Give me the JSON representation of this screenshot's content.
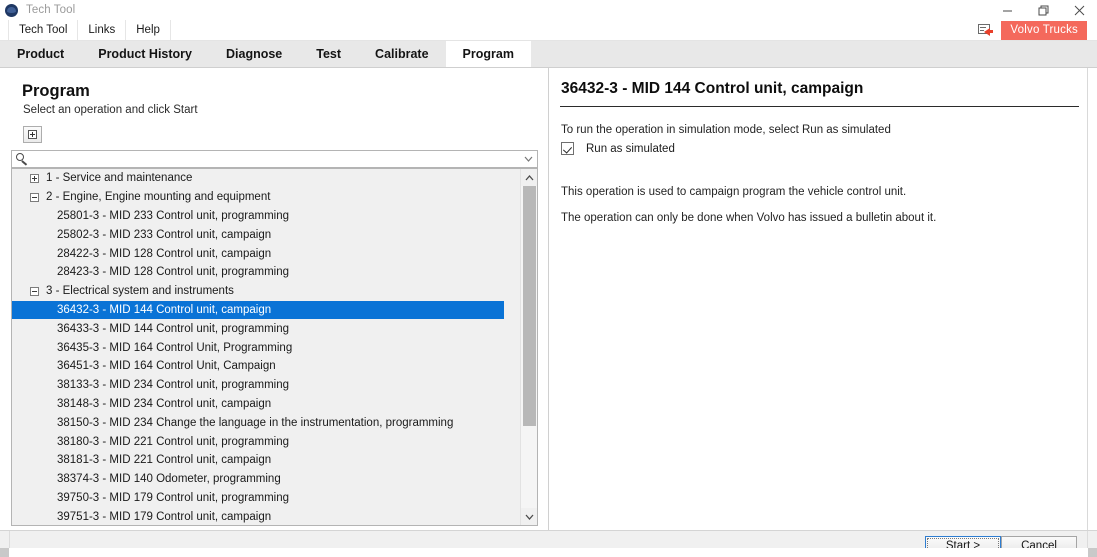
{
  "window": {
    "title": "Tech Tool",
    "icon": "volvo-tech-tool-logo",
    "controls": {
      "minimize": "minimize-icon",
      "restore": "restore-icon",
      "close": "close-icon"
    }
  },
  "menubar": {
    "items": [
      {
        "label": "Tech Tool"
      },
      {
        "label": "Links"
      },
      {
        "label": "Help"
      }
    ]
  },
  "brand": {
    "badge": "Volvo Trucks",
    "badge_color": "#f4695c",
    "connection_icon": "computer-connection-icon"
  },
  "tabs": {
    "items": [
      {
        "label": "Product",
        "active": false
      },
      {
        "label": "Product History",
        "active": false
      },
      {
        "label": "Diagnose",
        "active": false
      },
      {
        "label": "Test",
        "active": false
      },
      {
        "label": "Calibrate",
        "active": false
      },
      {
        "label": "Program",
        "active": true
      }
    ]
  },
  "left": {
    "title": "Program",
    "subtitle": "Select an operation and click Start",
    "expand_all_tooltip": "Expand all",
    "search": {
      "value": "",
      "placeholder": ""
    },
    "tree": [
      {
        "type": "group",
        "toggle": "plus",
        "label": "1 - Service and maintenance"
      },
      {
        "type": "group",
        "toggle": "minus",
        "label": "2 - Engine, Engine mounting and equipment"
      },
      {
        "type": "leaf",
        "label": "25801-3 - MID 233 Control unit, programming"
      },
      {
        "type": "leaf",
        "label": "25802-3 - MID 233 Control unit, campaign"
      },
      {
        "type": "leaf",
        "label": "28422-3 - MID 128 Control unit, campaign"
      },
      {
        "type": "leaf",
        "label": "28423-3 - MID 128 Control unit, programming"
      },
      {
        "type": "group",
        "toggle": "minus",
        "label": "3 - Electrical system and instruments"
      },
      {
        "type": "leaf",
        "selected": true,
        "label": "36432-3 - MID 144 Control unit, campaign"
      },
      {
        "type": "leaf",
        "label": "36433-3 - MID 144 Control unit, programming"
      },
      {
        "type": "leaf",
        "label": "36435-3 - MID 164 Control Unit, Programming"
      },
      {
        "type": "leaf",
        "label": "36451-3 - MID 164 Control Unit, Campaign"
      },
      {
        "type": "leaf",
        "label": "38133-3 - MID 234 Control unit, programming"
      },
      {
        "type": "leaf",
        "label": "38148-3 - MID 234 Control unit, campaign"
      },
      {
        "type": "leaf",
        "label": "38150-3 - MID 234 Change the language in the instrumentation, programming"
      },
      {
        "type": "leaf",
        "label": "38180-3 - MID 221 Control unit, programming"
      },
      {
        "type": "leaf",
        "label": "38181-3 - MID 221 Control unit, campaign"
      },
      {
        "type": "leaf",
        "label": "38374-3 - MID 140 Odometer, programming"
      },
      {
        "type": "leaf",
        "label": "39750-3 - MID 179 Control unit, programming"
      },
      {
        "type": "leaf",
        "label": "39751-3 - MID 179 Control unit, campaign"
      }
    ],
    "selection_color": "#0a73d6"
  },
  "right": {
    "title": "36432-3 - MID 144 Control unit, campaign",
    "hint": "To run the operation in simulation mode, select Run as simulated",
    "simulated": {
      "label": "Run as simulated",
      "checked": true
    },
    "paragraph1": "This operation is used to campaign program the vehicle control unit.",
    "paragraph2": "The operation can only be done when Volvo has issued a bulletin about it."
  },
  "footer": {
    "start_label": "Start >",
    "cancel_label": "Cancel"
  }
}
